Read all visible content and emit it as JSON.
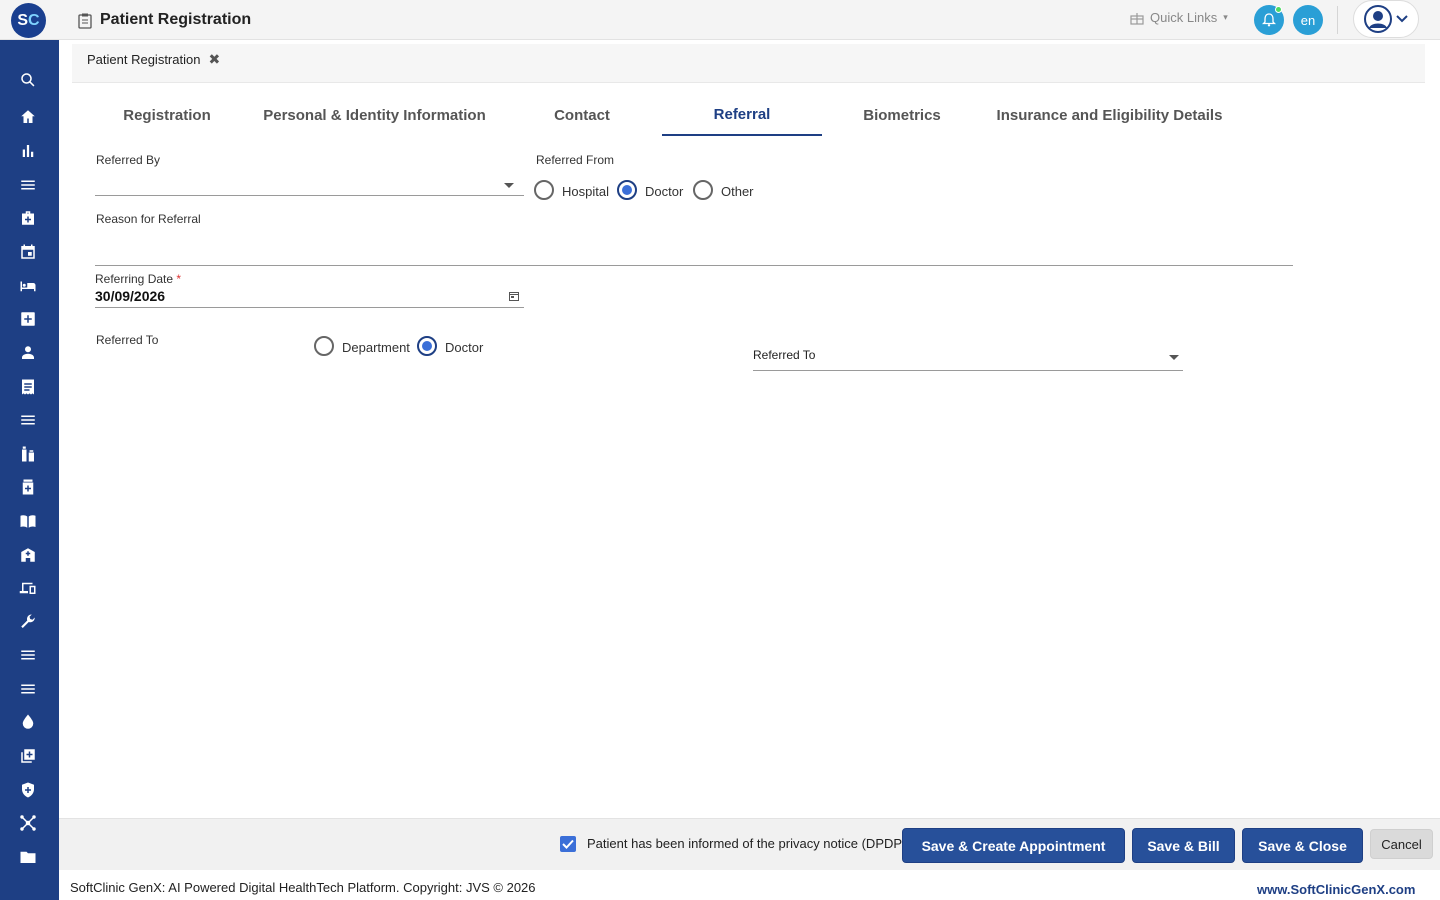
{
  "app": {
    "logo_s": "S",
    "logo_c": "C",
    "title": "Patient Registration"
  },
  "header": {
    "quick_links": "Quick Links",
    "lang": "en"
  },
  "page_tab": {
    "label": "Patient Registration",
    "close": "✖"
  },
  "tabs": [
    {
      "label": "Registration"
    },
    {
      "label": "Personal & Identity Information"
    },
    {
      "label": "Contact"
    },
    {
      "label": "Referral"
    },
    {
      "label": "Biometrics"
    },
    {
      "label": "Insurance and Eligibility Details"
    }
  ],
  "active_tab": "Referral",
  "form": {
    "referred_by_label": "Referred By",
    "referred_by_value": "",
    "referred_from_label": "Referred From",
    "referred_from_options": [
      "Hospital",
      "Doctor",
      "Other"
    ],
    "referred_from_selected": "Doctor",
    "reason_label": "Reason for Referral",
    "reason_value": "",
    "referring_date_label": "Referring Date",
    "required_mark": "*",
    "referring_date_value": "30/09/2026",
    "referred_to_label": "Referred To",
    "referred_to_options": [
      "Department",
      "Doctor"
    ],
    "referred_to_selected": "Doctor",
    "referred_to_select_placeholder": "Referred To"
  },
  "actions": {
    "privacy_checkbox_label": "Patient has been informed of the privacy notice (DPDP)",
    "privacy_checked": true,
    "save_create_appointment": "Save & Create Appointment",
    "save_bill": "Save & Bill",
    "save_close": "Save & Close",
    "cancel": "Cancel"
  },
  "footer": {
    "copyright": "SoftClinic GenX: AI Powered Digital HealthTech Platform. Copyright: JVS © 2026",
    "website": "www.SoftClinicGenX.com"
  },
  "sidebar": {
    "icons": [
      "search-icon",
      "home-icon",
      "bar-chart-icon",
      "menu-icon",
      "medical-bag-icon",
      "calendar-icon",
      "bed-icon",
      "medical-plus-icon",
      "person-icon",
      "receipt-icon",
      "list-icon",
      "bottles-icon",
      "medicine-icon",
      "book-icon",
      "hospital-building-icon",
      "devices-icon",
      "wrench-icon",
      "list-icon",
      "list-icon",
      "drop-icon",
      "add-box-icon",
      "shield-plus-icon",
      "hub-icon",
      "folder-icon"
    ]
  },
  "colors": {
    "brand": "#1e3f84",
    "accent": "#3b6fd8",
    "button": "#27509a",
    "notification": "#2a9fd6"
  }
}
